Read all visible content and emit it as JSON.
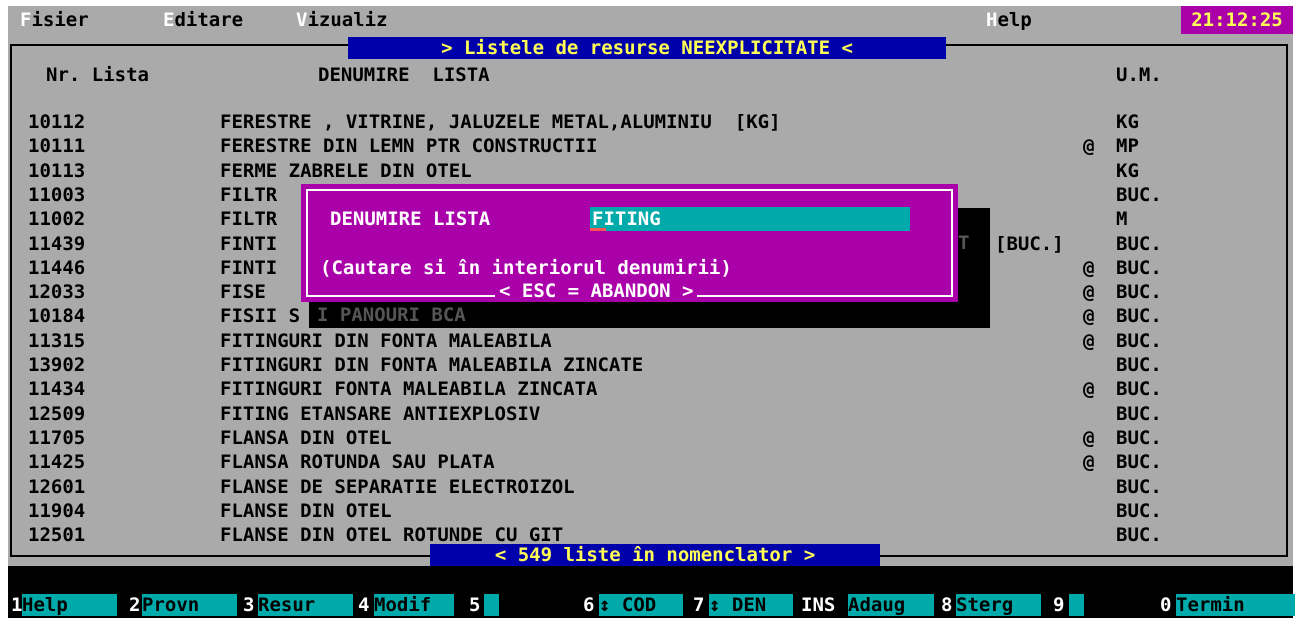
{
  "menu": {
    "items": [
      {
        "hot": "F",
        "rest": "isier"
      },
      {
        "hot": "E",
        "rest": "ditare"
      },
      {
        "hot": "V",
        "rest": "izualiz"
      },
      {
        "hot": "H",
        "rest": "elp"
      }
    ],
    "clock": "21:12:25"
  },
  "list": {
    "title": "> Listele de resurse NEEXPLICITATE  <",
    "columns": {
      "nr": "Nr. Lista",
      "name": "DENUMIRE  LISTA",
      "um": "U.M."
    },
    "rows": [
      {
        "nr": "10112",
        "name": "FERESTRE , VITRINE, JALUZELE METAL,ALUMINIU  [KG]",
        "flag": "",
        "um": "KG"
      },
      {
        "nr": "10111",
        "name": "FERESTRE DIN LEMN PTR CONSTRUCTII",
        "flag": "@",
        "um": "MP"
      },
      {
        "nr": "10113",
        "name": "FERME ZABRELE DIN OTEL",
        "flag": "",
        "um": "KG"
      },
      {
        "nr": "11003",
        "name": "FILTR",
        "flag": "",
        "um": "BUC."
      },
      {
        "nr": "11002",
        "name": "FILTR",
        "flag": "",
        "um": "M"
      },
      {
        "nr": "11439",
        "name": "FINTI",
        "flag": "",
        "tail": "[BUC.]",
        "um": "BUC."
      },
      {
        "nr": "11446",
        "name": "FINTI",
        "flag": "@",
        "um": "BUC."
      },
      {
        "nr": "12033",
        "name": "FISE",
        "flag": "@",
        "um": "BUC."
      },
      {
        "nr": "10184",
        "name": "FISII S",
        "flag": "@",
        "um": "BUC."
      },
      {
        "nr": "11315",
        "name": "FITINGURI DIN FONTA MALEABILA",
        "flag": "@",
        "um": "BUC."
      },
      {
        "nr": "13902",
        "name": "FITINGURI DIN FONTA MALEABILA ZINCATE",
        "flag": "",
        "um": "BUC."
      },
      {
        "nr": "11434",
        "name": "FITINGURI FONTA MALEABILA ZINCATA",
        "flag": "@",
        "um": "BUC."
      },
      {
        "nr": "12509",
        "name": "FITING ETANSARE ANTIEXPLOSIV",
        "flag": "",
        "um": "BUC."
      },
      {
        "nr": "11705",
        "name": "FLANSA DIN OTEL",
        "flag": "@",
        "um": "BUC."
      },
      {
        "nr": "11425",
        "name": "FLANSA ROTUNDA SAU PLATA",
        "flag": "@",
        "um": "BUC."
      },
      {
        "nr": "12601",
        "name": "FLANSE DE SEPARATIE ELECTROIZOL",
        "flag": "",
        "um": "BUC."
      },
      {
        "nr": "11904",
        "name": "FLANSE DIN OTEL",
        "flag": "",
        "um": "BUC."
      },
      {
        "nr": "12501",
        "name": "FLANSE DIN OTEL ROTUNDE CU GIT",
        "flag": "",
        "um": "BUC."
      }
    ],
    "footer": "< 549 liste în nomenclator >",
    "shadow_text": "I PANOURI BCA",
    "shadow_t": "T"
  },
  "dialog": {
    "label": "DENUMIRE LISTA",
    "value": "FITING",
    "hint": "(Cautare si în interiorul denumirii)",
    "esc": "< ESC = ABANDON >"
  },
  "fkeys": [
    {
      "num": "1",
      "label": "Help "
    },
    {
      "num": "2",
      "label": "Provn"
    },
    {
      "num": "3",
      "label": "Resur"
    },
    {
      "num": "4",
      "label": "Modif"
    },
    {
      "num": "5",
      "label": "     "
    },
    {
      "num": "6",
      "label": "↕ COD"
    },
    {
      "num": "7",
      "label": "↕ DEN"
    },
    {
      "num": "INS",
      "label": "Adaug"
    },
    {
      "num": "8",
      "label": "Sterg"
    },
    {
      "num": "9",
      "label": "     "
    },
    {
      "num": "0",
      "label": "Termin"
    }
  ],
  "colors": {
    "menu": "#aaaaaa",
    "title_bg": "#0000aa",
    "title_fg": "#ffff55",
    "dialog": "#aa00aa",
    "input": "#00aaaa"
  }
}
